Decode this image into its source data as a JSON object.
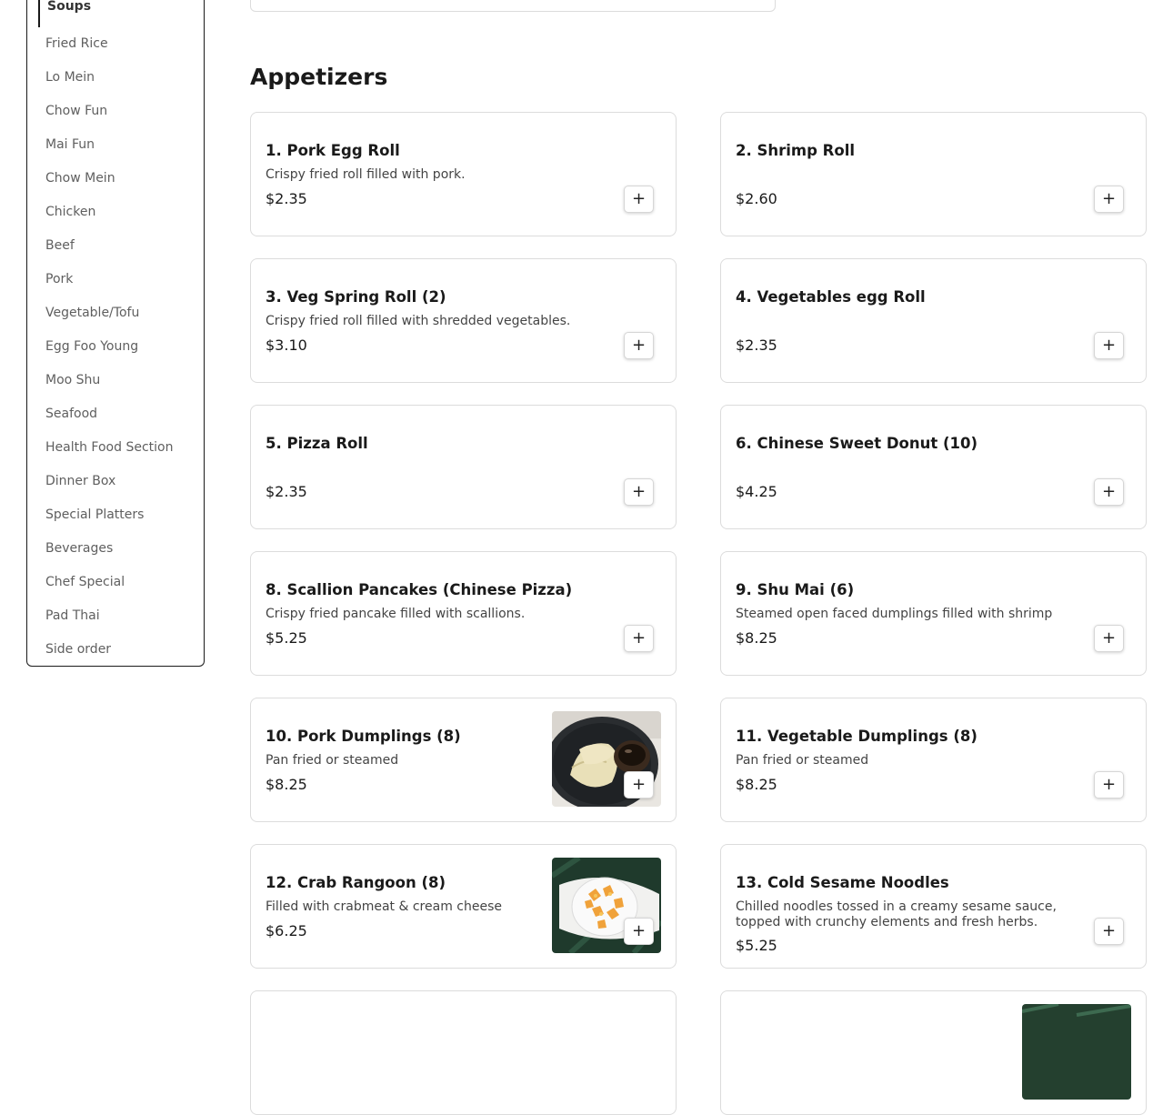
{
  "sidebar": {
    "active": "Soups",
    "items": [
      "Fried Rice",
      "Lo Mein",
      "Chow Fun",
      "Mai Fun",
      "Chow Mein",
      "Chicken",
      "Beef",
      "Pork",
      "Vegetable/Tofu",
      "Egg Foo Young",
      "Moo Shu",
      "Seafood",
      "Health Food Section",
      "Dinner Box",
      "Special Platters",
      "Beverages",
      "Chef Special",
      "Pad Thai",
      "Side order"
    ]
  },
  "section": {
    "title": "Appetizers"
  },
  "add_label": "+",
  "items": [
    {
      "name": "1. Pork Egg Roll",
      "desc": "Crispy fried roll filled with pork.",
      "price": "$2.35"
    },
    {
      "name": "2. Shrimp Roll",
      "desc": "",
      "price": "$2.60"
    },
    {
      "name": "3. Veg Spring Roll (2)",
      "desc": "Crispy fried roll filled with shredded vegetables.",
      "price": "$3.10"
    },
    {
      "name": "4. Vegetables egg Roll",
      "desc": "",
      "price": "$2.35"
    },
    {
      "name": "5. Pizza Roll",
      "desc": "",
      "price": "$2.35"
    },
    {
      "name": "6. Chinese Sweet Donut (10)",
      "desc": "",
      "price": "$4.25"
    },
    {
      "name": "8. Scallion Pancakes (Chinese Pizza)",
      "desc": "Crispy fried pancake filled with scallions.",
      "price": "$5.25"
    },
    {
      "name": "9. Shu Mai (6)",
      "desc": "Steamed open faced dumplings filled with shrimp",
      "price": "$8.25"
    },
    {
      "name": "10. Pork Dumplings (8)",
      "desc": "Pan fried or steamed",
      "price": "$8.25"
    },
    {
      "name": "11. Vegetable Dumplings (8)",
      "desc": "Pan fried or steamed",
      "price": "$8.25"
    },
    {
      "name": "12. Crab Rangoon (8)",
      "desc": "Filled with crabmeat & cream cheese",
      "price": "$6.25"
    },
    {
      "name": "13. Cold Sesame Noodles",
      "desc": "Chilled noodles tossed in a creamy sesame sauce, topped with crunchy elements and fresh herbs.",
      "price": "$5.25"
    }
  ]
}
